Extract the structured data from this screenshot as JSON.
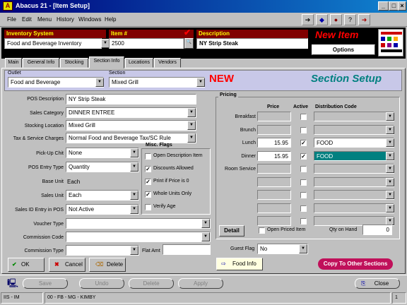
{
  "window": {
    "title": "Abacus 21 - [Item Setup]",
    "app_icon": "A"
  },
  "menu": [
    "File",
    "Edit",
    "Menu",
    "History",
    "Windows",
    "Help"
  ],
  "header": {
    "inventory_system_label": "Inventory System",
    "inventory_system_value": "Food and Beverage Inventory",
    "item_num_label": "Item #",
    "item_num_value": "2500",
    "description_label": "Description",
    "description_value": "NY Strip Steak",
    "new_item": "New Item",
    "options_button": "Options"
  },
  "tabs": [
    "Main",
    "General Info",
    "Stocking",
    "Section Info",
    "Locations",
    "Vendors"
  ],
  "selected_tab": "Section Info",
  "outlet": {
    "outlet_label": "Outlet",
    "outlet_value": "Food and Beverage",
    "section_label": "Section",
    "section_value": "Mixed Grill",
    "new_badge": "NEW",
    "heading": "Section Setup"
  },
  "form": {
    "pos_description": {
      "label": "POS Description",
      "value": "NY Strip Steak"
    },
    "sales_category": {
      "label": "Sales Category",
      "value": "DINNER ENTREE"
    },
    "stocking_location": {
      "label": "Stocking Location",
      "value": "Mixed Grill"
    },
    "tax_service": {
      "label": "Tax & Service Charges",
      "value": "Normal Food and Beverage Tax/SC Rule"
    },
    "pickup_chit": {
      "label": "Pick-Up Chit",
      "value": "None"
    },
    "pos_entry_type": {
      "label": "POS Entry Type",
      "value": "Quantity"
    },
    "base_unit": {
      "label": "Base Unit",
      "value": "Each"
    },
    "sales_unit": {
      "label": "Sales Unit",
      "value": "Each"
    },
    "sales_id_entry": {
      "label": "Sales ID Entry in POS",
      "value": "Not Active"
    },
    "voucher_type": {
      "label": "Voucher Type",
      "value": ""
    },
    "commission_code": {
      "label": "Commission Code",
      "value": ""
    },
    "commission_type": {
      "label": "Commission Type",
      "value": ""
    },
    "flat_amt": {
      "label": "Flat Amt",
      "value": ""
    }
  },
  "misc_flags": {
    "title": "Misc. Flags",
    "items": [
      {
        "label": "Open Description Item",
        "checked": false
      },
      {
        "label": "Discounts Allowed",
        "checked": true
      },
      {
        "label": "Print if Price is 0",
        "checked": true
      },
      {
        "label": "Whole Units Only",
        "checked": true
      },
      {
        "label": "Verify Age",
        "checked": false
      }
    ]
  },
  "pricing": {
    "title": "Pricing",
    "col_price": "Price",
    "col_active": "Active",
    "col_dist": "Distribution Code",
    "rows": [
      {
        "label": "Breakfast",
        "price": "",
        "active": false,
        "dist": "",
        "enabled": false
      },
      {
        "label": "Brunch",
        "price": "",
        "active": false,
        "dist": "",
        "enabled": false
      },
      {
        "label": "Lunch",
        "price": "15.95",
        "active": true,
        "dist": "FOOD",
        "enabled": true
      },
      {
        "label": "Dinner",
        "price": "15.95",
        "active": true,
        "dist": "FOOD",
        "enabled": true
      },
      {
        "label": "Room Service",
        "price": "",
        "active": false,
        "dist": "",
        "enabled": false
      },
      {
        "label": "",
        "price": "",
        "active": false,
        "dist": "",
        "enabled": false
      },
      {
        "label": "",
        "price": "",
        "active": false,
        "dist": "",
        "enabled": false
      },
      {
        "label": "",
        "price": "",
        "active": false,
        "dist": "",
        "enabled": false
      },
      {
        "label": "",
        "price": "",
        "active": false,
        "dist": "",
        "enabled": false
      }
    ],
    "detail_button": "Detail",
    "open_priced_label": "Open Priced Item",
    "qty_on_hand_label": "Qty on Hand",
    "qty_on_hand_value": "0"
  },
  "guest_flag": {
    "label": "Guest Flag",
    "value": "No"
  },
  "buttons": {
    "ok": "OK",
    "cancel": "Cancel",
    "delete": "Delete",
    "food_info": "Food Info",
    "copy_sections": "Copy To Other Sections"
  },
  "toolbar2": {
    "save": "Save",
    "undo": "Undo",
    "delete": "Delete",
    "apply": "Apply",
    "close": "Close"
  },
  "status": {
    "left": "IIS - IM",
    "middle": "00 - FB - MG - KIMBY",
    "right": "1"
  },
  "colors": {
    "title_bar": "#00007b",
    "new_red": "#ff0000",
    "heading_teal": "#008080",
    "label_maroon": "#800000",
    "selection": "#008080",
    "copy_button": "#c0105a"
  }
}
